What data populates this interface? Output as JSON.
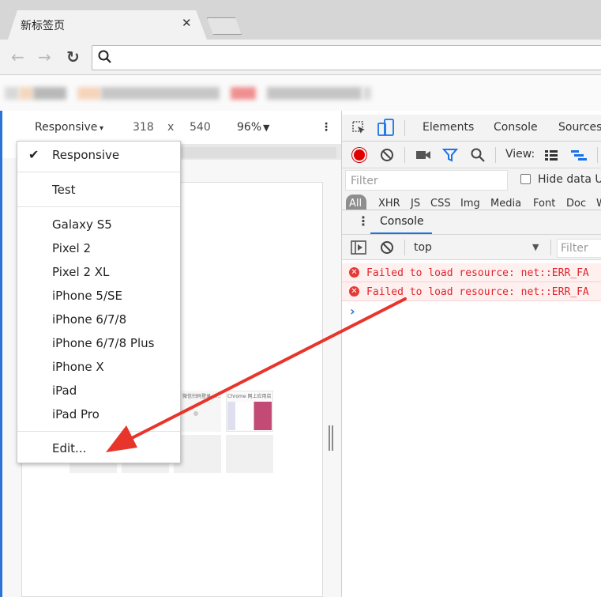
{
  "browser": {
    "tab_title": "新标签页",
    "tab_close": "✕",
    "nav": {
      "back": "←",
      "forward": "→",
      "reload": "↻"
    }
  },
  "device_toolbar": {
    "device": "Responsive",
    "caret": "▾",
    "width": "318",
    "times": "x",
    "height": "540",
    "zoom": "96%",
    "zoom_caret": "▼",
    "more": "⋮"
  },
  "device_menu": {
    "checked_item": "Responsive",
    "check_mark": "✔",
    "groups": [
      [
        "Responsive"
      ],
      [
        "Test"
      ],
      [
        "Galaxy S5",
        "Pixel 2",
        "Pixel 2 XL",
        "iPhone 5/SE",
        "iPhone 6/7/8",
        "iPhone 6/7/8 Plus",
        "iPhone X",
        "iPad",
        "iPad Pro"
      ],
      [
        "Edit..."
      ]
    ]
  },
  "viewport_thumbs": {
    "captions": [
      "微信扫码登录 - P...",
      "Chrome 网上应用店"
    ]
  },
  "devtools": {
    "tabs": [
      "Elements",
      "Console",
      "Sources"
    ],
    "view_label": "View:",
    "filter_placeholder": "Filter",
    "hide_data_urls": "Hide data U",
    "type_filters": [
      "All",
      "XHR",
      "JS",
      "CSS",
      "Img",
      "Media",
      "Font",
      "Doc",
      "W"
    ],
    "drawer_tab": "Console",
    "context": "top",
    "context_caret": "▼",
    "console_filter_placeholder": "Filter",
    "messages": [
      "Failed to load resource: net::ERR_FA",
      "Failed to load resource: net::ERR_FA"
    ],
    "prompt": "›"
  },
  "colors": {
    "error_text": "#e0242b",
    "error_bg": "#fff0f0",
    "accent_blue": "#2a74d8",
    "record_red": "#e00000",
    "arrow_red": "#e8352b"
  }
}
